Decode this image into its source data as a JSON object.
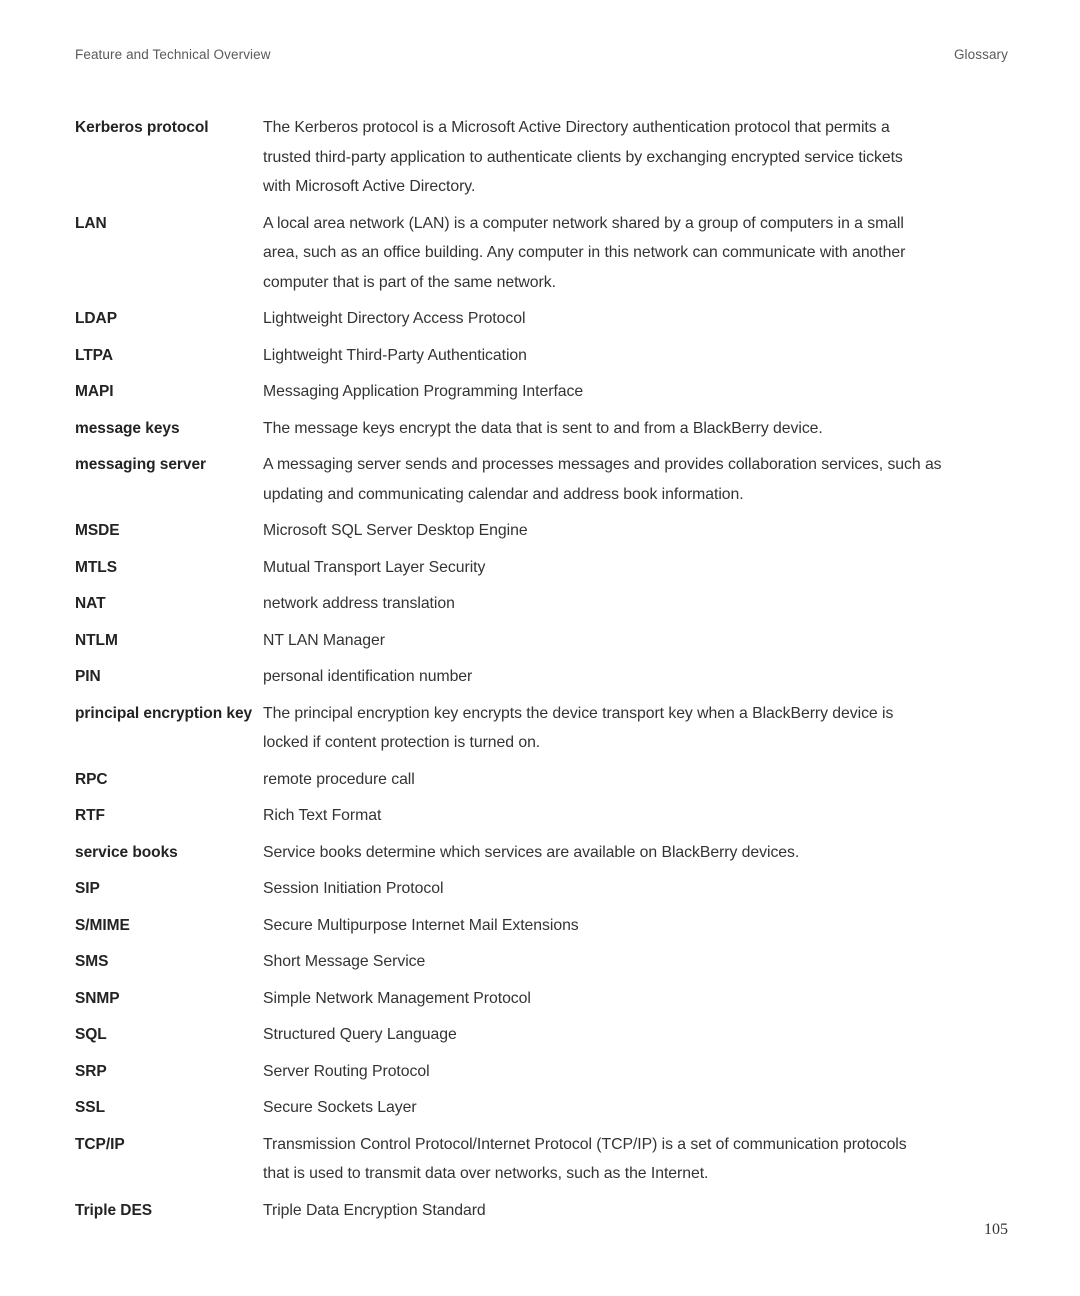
{
  "header": {
    "left_title": "Feature and Technical Overview",
    "right_title": "Glossary"
  },
  "footer": {
    "page_number": "105"
  },
  "glossary": {
    "entries": [
      {
        "term": "Kerberos protocol",
        "lines": [
          "The Kerberos protocol is a Microsoft Active Directory authentication protocol that permits a",
          "trusted third-party application to authenticate clients by exchanging encrypted service tickets",
          "with Microsoft Active Directory."
        ]
      },
      {
        "term": "LAN",
        "lines": [
          "A local area network (LAN) is a computer network shared by a group of computers in a small",
          "area, such as an office building. Any computer in this network can communicate with another",
          "computer that is part of the same network."
        ]
      },
      {
        "term": "LDAP",
        "lines": [
          "Lightweight Directory Access Protocol"
        ]
      },
      {
        "term": "LTPA",
        "lines": [
          "Lightweight Third-Party Authentication"
        ]
      },
      {
        "term": "MAPI",
        "lines": [
          "Messaging Application Programming Interface"
        ]
      },
      {
        "term": "message keys",
        "lines": [
          "The message keys encrypt the data that is sent to and from a BlackBerry device."
        ]
      },
      {
        "term": "messaging server",
        "lines": [
          "A messaging server sends and processes messages and provides collaboration services, such as",
          "updating and communicating calendar and address book information."
        ]
      },
      {
        "term": "MSDE",
        "lines": [
          "Microsoft SQL Server Desktop Engine"
        ]
      },
      {
        "term": "MTLS",
        "lines": [
          "Mutual Transport Layer Security"
        ]
      },
      {
        "term": "NAT",
        "lines": [
          "network address translation"
        ]
      },
      {
        "term": "NTLM",
        "lines": [
          "NT LAN Manager"
        ]
      },
      {
        "term": "PIN",
        "lines": [
          "personal identification number"
        ]
      },
      {
        "term": "principal encryption key",
        "lines": [
          "The principal encryption key encrypts the device transport key when a BlackBerry device is",
          "locked if content protection is turned on."
        ]
      },
      {
        "term": "RPC",
        "lines": [
          "remote procedure call"
        ]
      },
      {
        "term": "RTF",
        "lines": [
          "Rich Text Format"
        ]
      },
      {
        "term": "service books",
        "lines": [
          "Service books determine which services are available on BlackBerry devices."
        ]
      },
      {
        "term": "SIP",
        "lines": [
          "Session Initiation Protocol"
        ]
      },
      {
        "term": "S/MIME",
        "lines": [
          "Secure Multipurpose Internet Mail Extensions"
        ]
      },
      {
        "term": "SMS",
        "lines": [
          "Short Message Service"
        ]
      },
      {
        "term": "SNMP",
        "lines": [
          "Simple Network Management Protocol"
        ]
      },
      {
        "term": "SQL",
        "lines": [
          "Structured Query Language"
        ]
      },
      {
        "term": "SRP",
        "lines": [
          "Server Routing Protocol"
        ]
      },
      {
        "term": "SSL",
        "lines": [
          "Secure Sockets Layer"
        ]
      },
      {
        "term": "TCP/IP",
        "lines": [
          "Transmission Control Protocol/Internet Protocol (TCP/IP) is a set of communication protocols",
          "that is used to transmit data over networks, such as the Internet."
        ]
      },
      {
        "term": "Triple DES",
        "lines": [
          "Triple Data Encryption Standard"
        ]
      }
    ]
  }
}
